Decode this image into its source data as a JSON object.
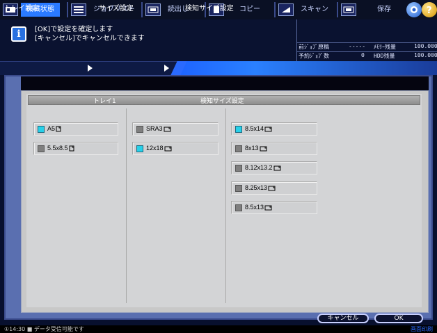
{
  "tabs": [
    {
      "label": "機械状態",
      "icon": "machine-status-icon",
      "active": true
    },
    {
      "label": "ジョブリスト",
      "icon": "job-list-icon",
      "active": false
    },
    {
      "label": "読出し",
      "icon": "recall-icon",
      "active": false
    },
    {
      "label": "コピー",
      "icon": "copy-icon",
      "active": false
    },
    {
      "label": "スキャン",
      "icon": "scan-icon",
      "active": false
    },
    {
      "label": "保存",
      "icon": "save-icon",
      "active": false
    }
  ],
  "message": {
    "line1": "[OK]で設定を確定します",
    "line2": "[キャンセル]でキャンセルできます"
  },
  "stats": {
    "prev_job_label": "前ｼﾞｮﾌﾞ原稿",
    "prev_job_value": "-----",
    "memory_label": "ﾒﾓﾘｰ残量",
    "memory_value": "100.000",
    "reserved_label": "予約ｼﾞｮﾌﾞ数",
    "reserved_value": "0",
    "hdd_label": "HDD残量",
    "hdd_value": "100.000"
  },
  "breadcrumb": [
    "トレイ設定",
    "サイズ設定",
    "検知サイズ設定"
  ],
  "table": {
    "header_left": "トレイ1",
    "header_right": "検知サイズ設定",
    "col1": [
      {
        "label": "A5",
        "checked": true
      },
      {
        "label": "5.5x8.5",
        "checked": false
      }
    ],
    "col2": [
      {
        "label": "SRA3",
        "checked": false
      },
      {
        "label": "12x18",
        "checked": true
      }
    ],
    "col3": [
      {
        "label": "8.5x14",
        "checked": true
      },
      {
        "label": "8x13",
        "checked": false
      },
      {
        "label": "8.12x13.2",
        "checked": false
      },
      {
        "label": "8.25x13",
        "checked": false
      },
      {
        "label": "8.5x13",
        "checked": false
      }
    ]
  },
  "buttons": {
    "cancel": "キャンセル",
    "ok": "OK"
  },
  "status": {
    "text": "①14:30 ■ データ受信可能です",
    "right": "画面印刷"
  },
  "colors": {
    "accent": "#2a7aff",
    "checked": "#27d0e8"
  }
}
